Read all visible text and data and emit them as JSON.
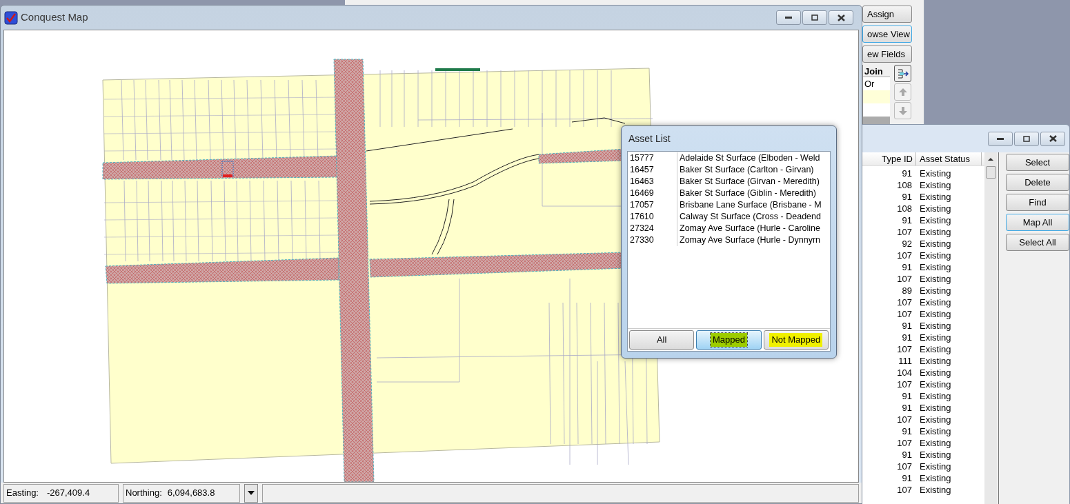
{
  "background_app": {
    "buttons": [
      {
        "label": "Assign",
        "focused": false
      },
      {
        "label": "owse View",
        "focused": true
      },
      {
        "label": "ew Fields",
        "focused": false
      }
    ],
    "join_table": {
      "header": "Join",
      "rows": [
        "Or"
      ]
    }
  },
  "list_window": {
    "columns": [
      "Type ID",
      "Asset Status"
    ],
    "rows": [
      {
        "type_id": "91",
        "status": "Existing"
      },
      {
        "type_id": "108",
        "status": "Existing"
      },
      {
        "type_id": "91",
        "status": "Existing"
      },
      {
        "type_id": "108",
        "status": "Existing"
      },
      {
        "type_id": "91",
        "status": "Existing"
      },
      {
        "type_id": "107",
        "status": "Existing"
      },
      {
        "type_id": "92",
        "status": "Existing"
      },
      {
        "type_id": "107",
        "status": "Existing"
      },
      {
        "type_id": "91",
        "status": "Existing"
      },
      {
        "type_id": "107",
        "status": "Existing"
      },
      {
        "type_id": "89",
        "status": "Existing"
      },
      {
        "type_id": "107",
        "status": "Existing"
      },
      {
        "type_id": "107",
        "status": "Existing"
      },
      {
        "type_id": "91",
        "status": "Existing"
      },
      {
        "type_id": "91",
        "status": "Existing"
      },
      {
        "type_id": "107",
        "status": "Existing"
      },
      {
        "type_id": "111",
        "status": "Existing"
      },
      {
        "type_id": "104",
        "status": "Existing"
      },
      {
        "type_id": "107",
        "status": "Existing"
      },
      {
        "type_id": "91",
        "status": "Existing"
      },
      {
        "type_id": "91",
        "status": "Existing"
      },
      {
        "type_id": "107",
        "status": "Existing"
      },
      {
        "type_id": "91",
        "status": "Existing"
      },
      {
        "type_id": "107",
        "status": "Existing"
      },
      {
        "type_id": "91",
        "status": "Existing"
      },
      {
        "type_id": "107",
        "status": "Existing"
      },
      {
        "type_id": "91",
        "status": "Existing"
      },
      {
        "type_id": "107",
        "status": "Existing"
      }
    ],
    "buttons": [
      {
        "label": "Select",
        "focused": false
      },
      {
        "label": "Delete",
        "focused": false
      },
      {
        "label": "Find",
        "focused": false
      },
      {
        "label": "Map All",
        "focused": true
      },
      {
        "label": "Select All",
        "focused": false
      }
    ]
  },
  "map_window": {
    "title": "Conquest Map",
    "status_bar": {
      "easting_label": "Easting:",
      "easting": "-267,409.4",
      "northing_label": "Northing:",
      "northing": "6,094,683.8"
    }
  },
  "asset_list": {
    "title": "Asset List",
    "items": [
      {
        "id": "15777",
        "name": "Adelaide St Surface (Elboden - Weld"
      },
      {
        "id": "16457",
        "name": "Baker St Surface (Carlton - Girvan)"
      },
      {
        "id": "16463",
        "name": "Baker St Surface (Girvan - Meredith)"
      },
      {
        "id": "16469",
        "name": "Baker St Surface (Giblin - Meredith)"
      },
      {
        "id": "17057",
        "name": "Brisbane Lane Surface (Brisbane - M"
      },
      {
        "id": "17610",
        "name": "Calway St Surface (Cross - Deadend"
      },
      {
        "id": "27324",
        "name": "Zomay Ave Surface (Hurle - Caroline"
      },
      {
        "id": "27330",
        "name": "Zomay Ave Surface (Hurle - Dynnyrn"
      }
    ],
    "filters": [
      {
        "label": "All",
        "selected": false
      },
      {
        "label": "Mapped",
        "selected": true,
        "color": "#9ccc00"
      },
      {
        "label": "Not Mapped",
        "selected": false,
        "color": "#f0f000"
      }
    ]
  }
}
